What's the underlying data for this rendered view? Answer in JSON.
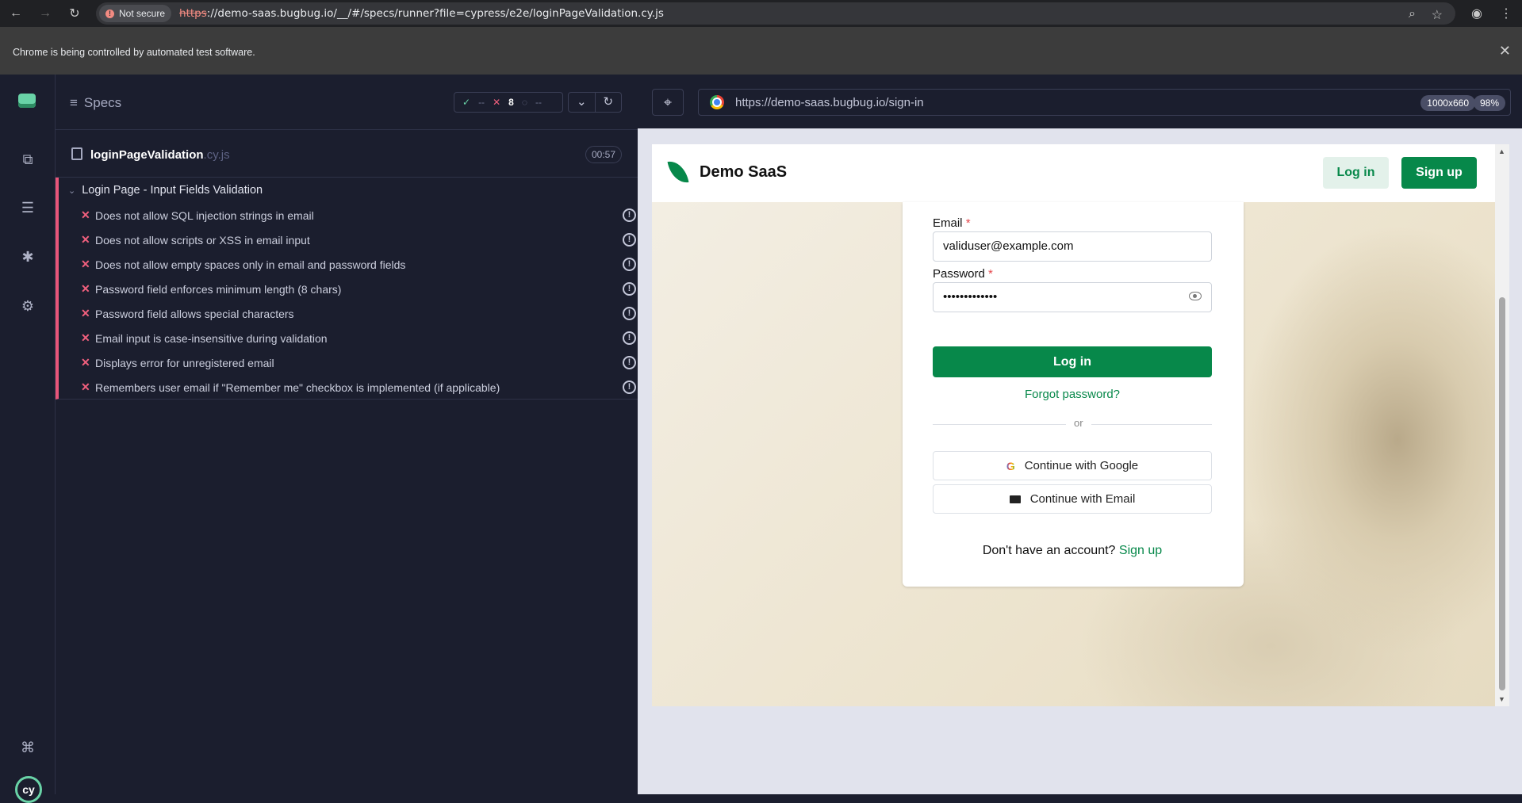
{
  "browser": {
    "security_chip": "Not secure",
    "url_scheme": "https",
    "url_rest": "://demo-saas.bugbug.io/__/#/specs/runner?file=cypress/e2e/loginPageValidation.cy.js",
    "automation_message": "Chrome is being controlled by automated test software."
  },
  "reporter": {
    "specs_label": "Specs",
    "stats": {
      "passed": "--",
      "failed": "8",
      "pending": "--"
    },
    "file": {
      "name": "loginPageValidation",
      "ext": ".cy.js",
      "duration": "00:57"
    },
    "suite_title": "Login Page - Input Fields Validation",
    "tests": [
      "Does not allow SQL injection strings in email",
      "Does not allow scripts or XSS in email input",
      "Does not allow empty spaces only in email and password fields",
      "Password field enforces minimum length (8 chars)",
      "Password field allows special characters",
      "Email input is case-insensitive during validation",
      "Displays error for unregistered email",
      "Remembers user email if \"Remember me\" checkbox is implemented (if applicable)"
    ]
  },
  "aut": {
    "url": "https://demo-saas.bugbug.io/sign-in",
    "viewport": "1000x660",
    "zoom": "98%"
  },
  "site": {
    "brand": "Demo SaaS",
    "header_login": "Log in",
    "header_signup": "Sign up",
    "email_label": "Email",
    "email_value": "validuser@example.com",
    "password_label": "Password",
    "password_value": "•••••••••••••",
    "login_button": "Log in",
    "forgot": "Forgot password?",
    "or": "or",
    "google": "Continue with Google",
    "email_btn": "Continue with Email",
    "no_account": "Don't have an account?",
    "signup_link": "Sign up"
  },
  "colors": {
    "brand_green": "#07884a",
    "fail_red": "#f2607e",
    "cypress_bg": "#1b1e2e"
  }
}
